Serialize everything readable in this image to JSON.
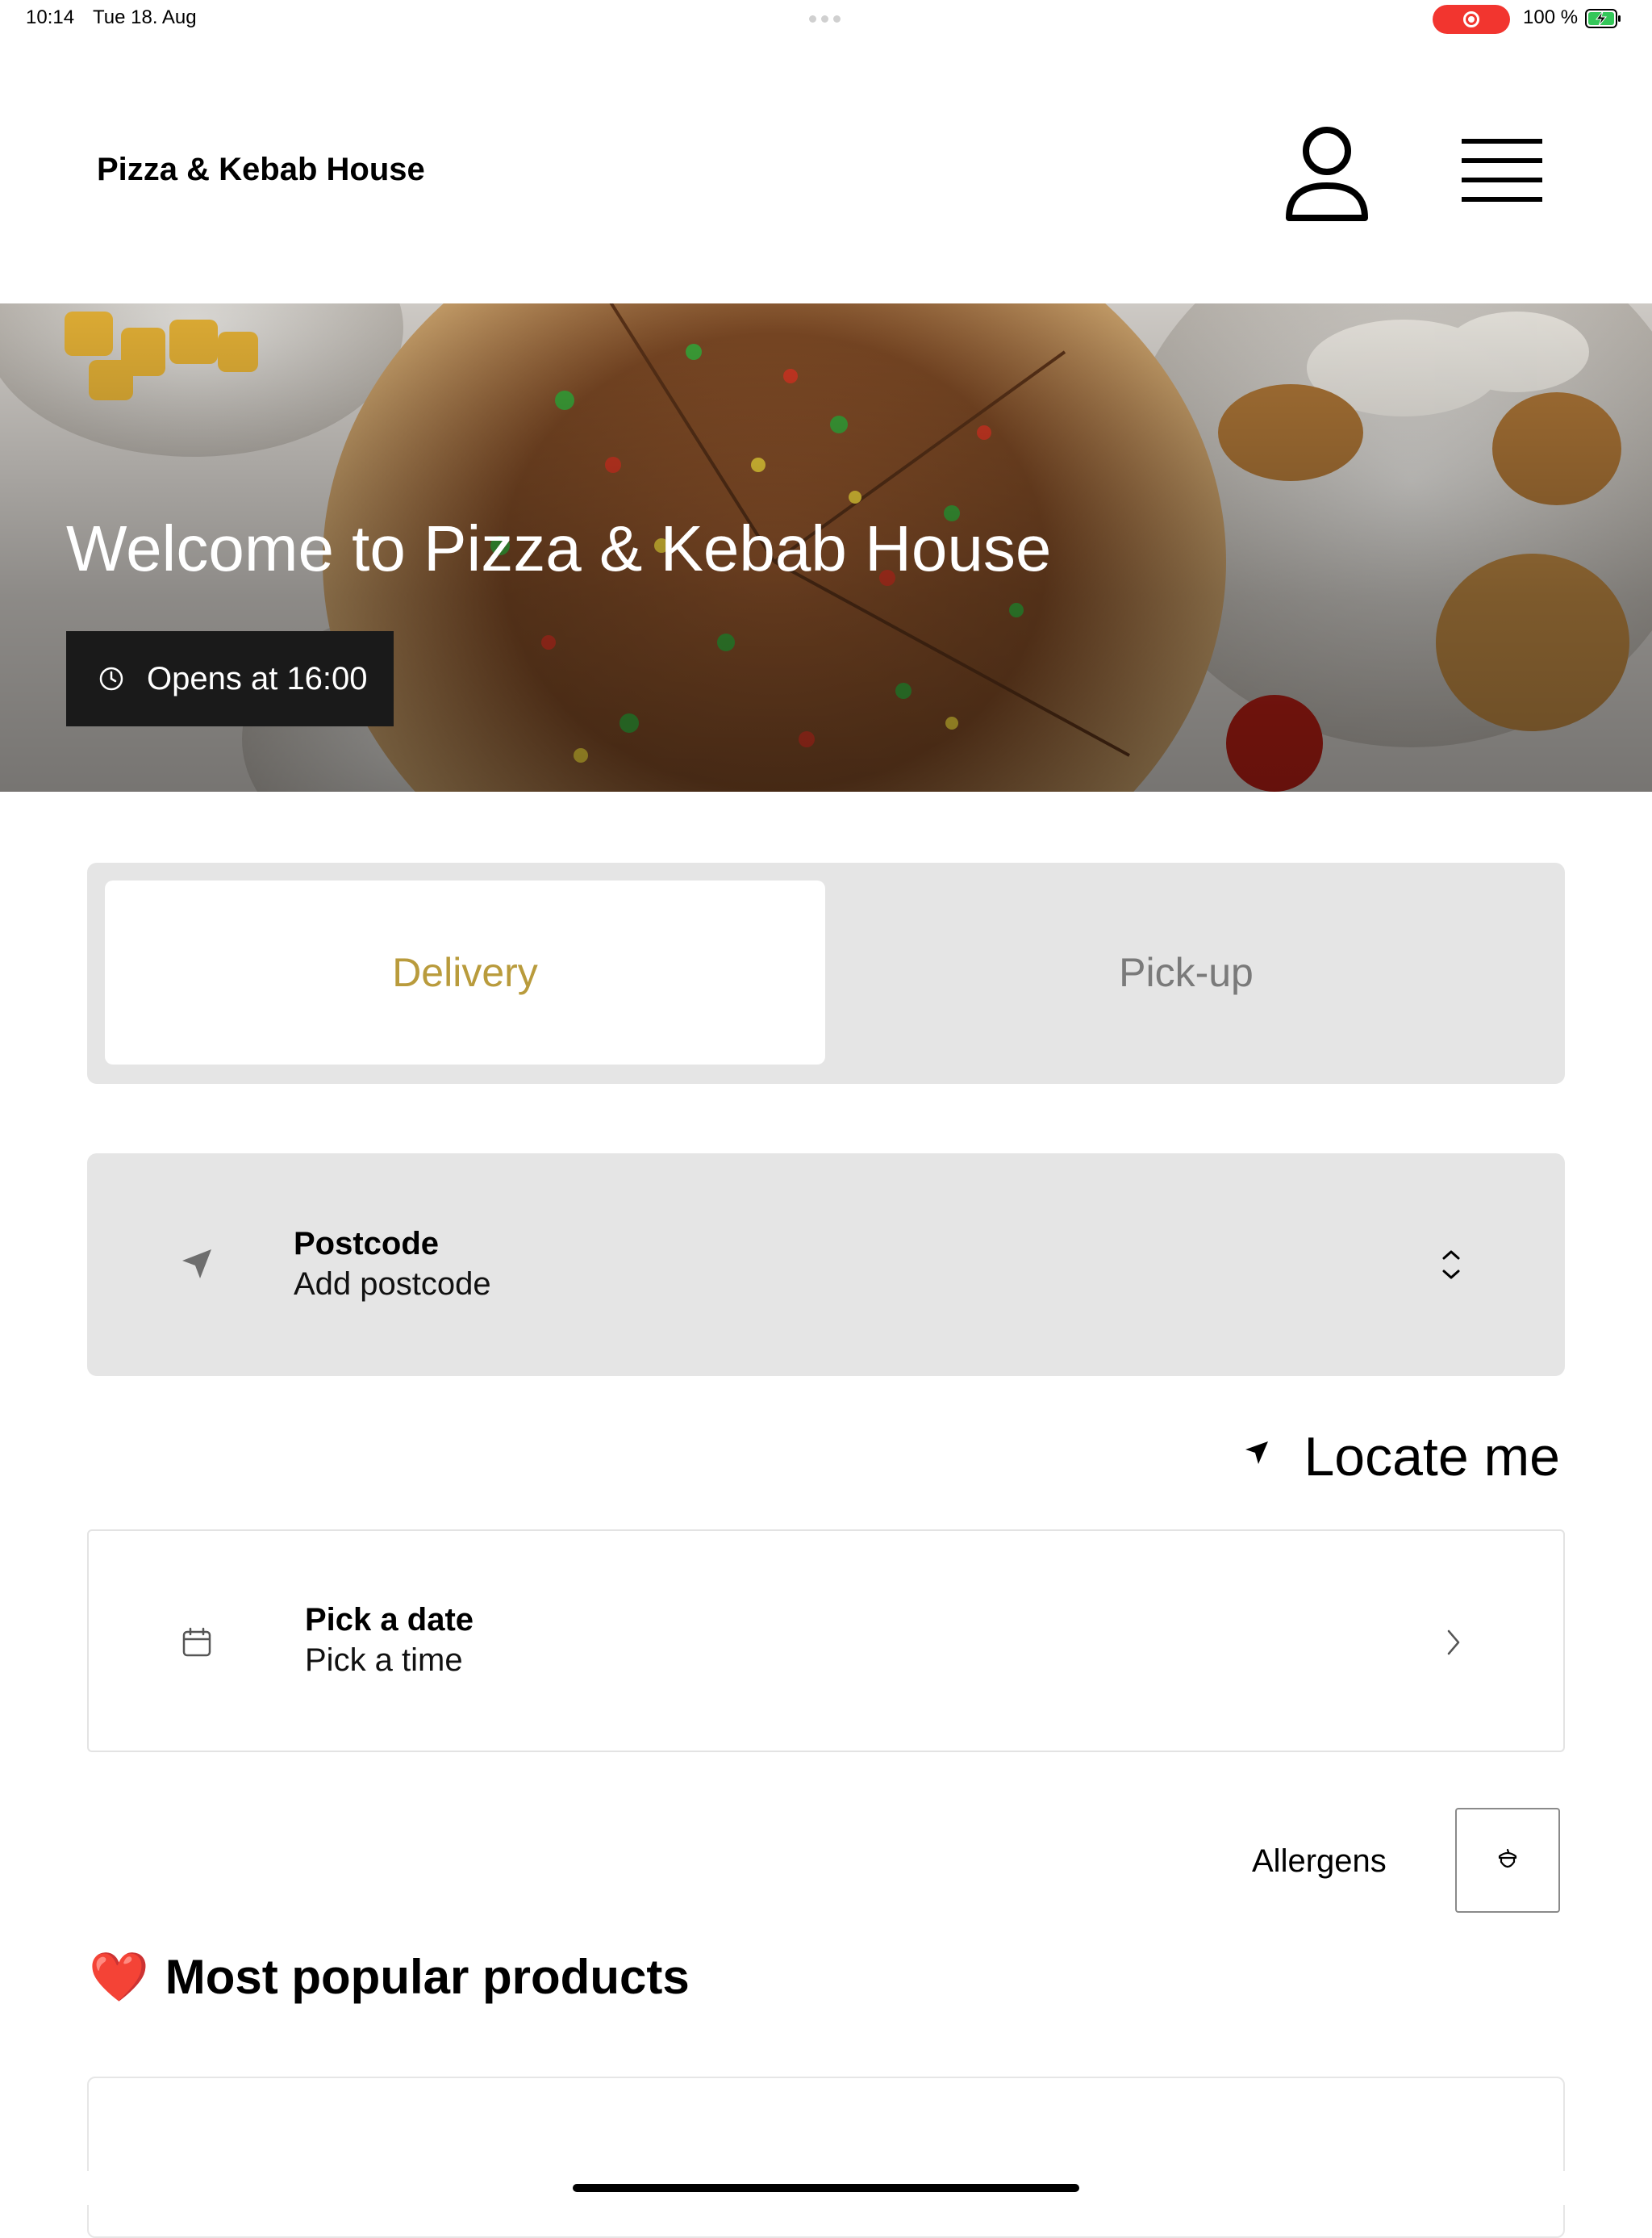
{
  "status_bar": {
    "time": "10:14",
    "date": "Tue 18. Aug",
    "battery": "100 %",
    "recording_color": "#f2352f"
  },
  "header": {
    "brand": "Pizza & Kebab House",
    "user_icon": "user-icon",
    "menu_icon": "hamburger-menu-icon"
  },
  "hero": {
    "title": "Welcome to Pizza & Kebab House",
    "opens_label": "Opens at 16:00",
    "clock_icon": "clock-icon"
  },
  "order_type": {
    "tabs": [
      {
        "label": "Delivery",
        "selected": true
      },
      {
        "label": "Pick-up",
        "selected": false
      }
    ],
    "accent_color": "#b99b3c"
  },
  "postcode": {
    "label": "Postcode",
    "value": "Add postcode",
    "icon": "navigation-arrow-icon",
    "toggle_icon": "chevron-up-down-icon"
  },
  "locate": {
    "label": "Locate me",
    "icon": "location-arrow-icon"
  },
  "schedule": {
    "label": "Pick a date",
    "value": "Pick a time",
    "icon": "calendar-icon",
    "chevron_icon": "chevron-right-icon"
  },
  "allergens": {
    "label": "Allergens",
    "icon": "acorn-icon"
  },
  "popular": {
    "heart": "❤️",
    "title": "Most popular products"
  }
}
